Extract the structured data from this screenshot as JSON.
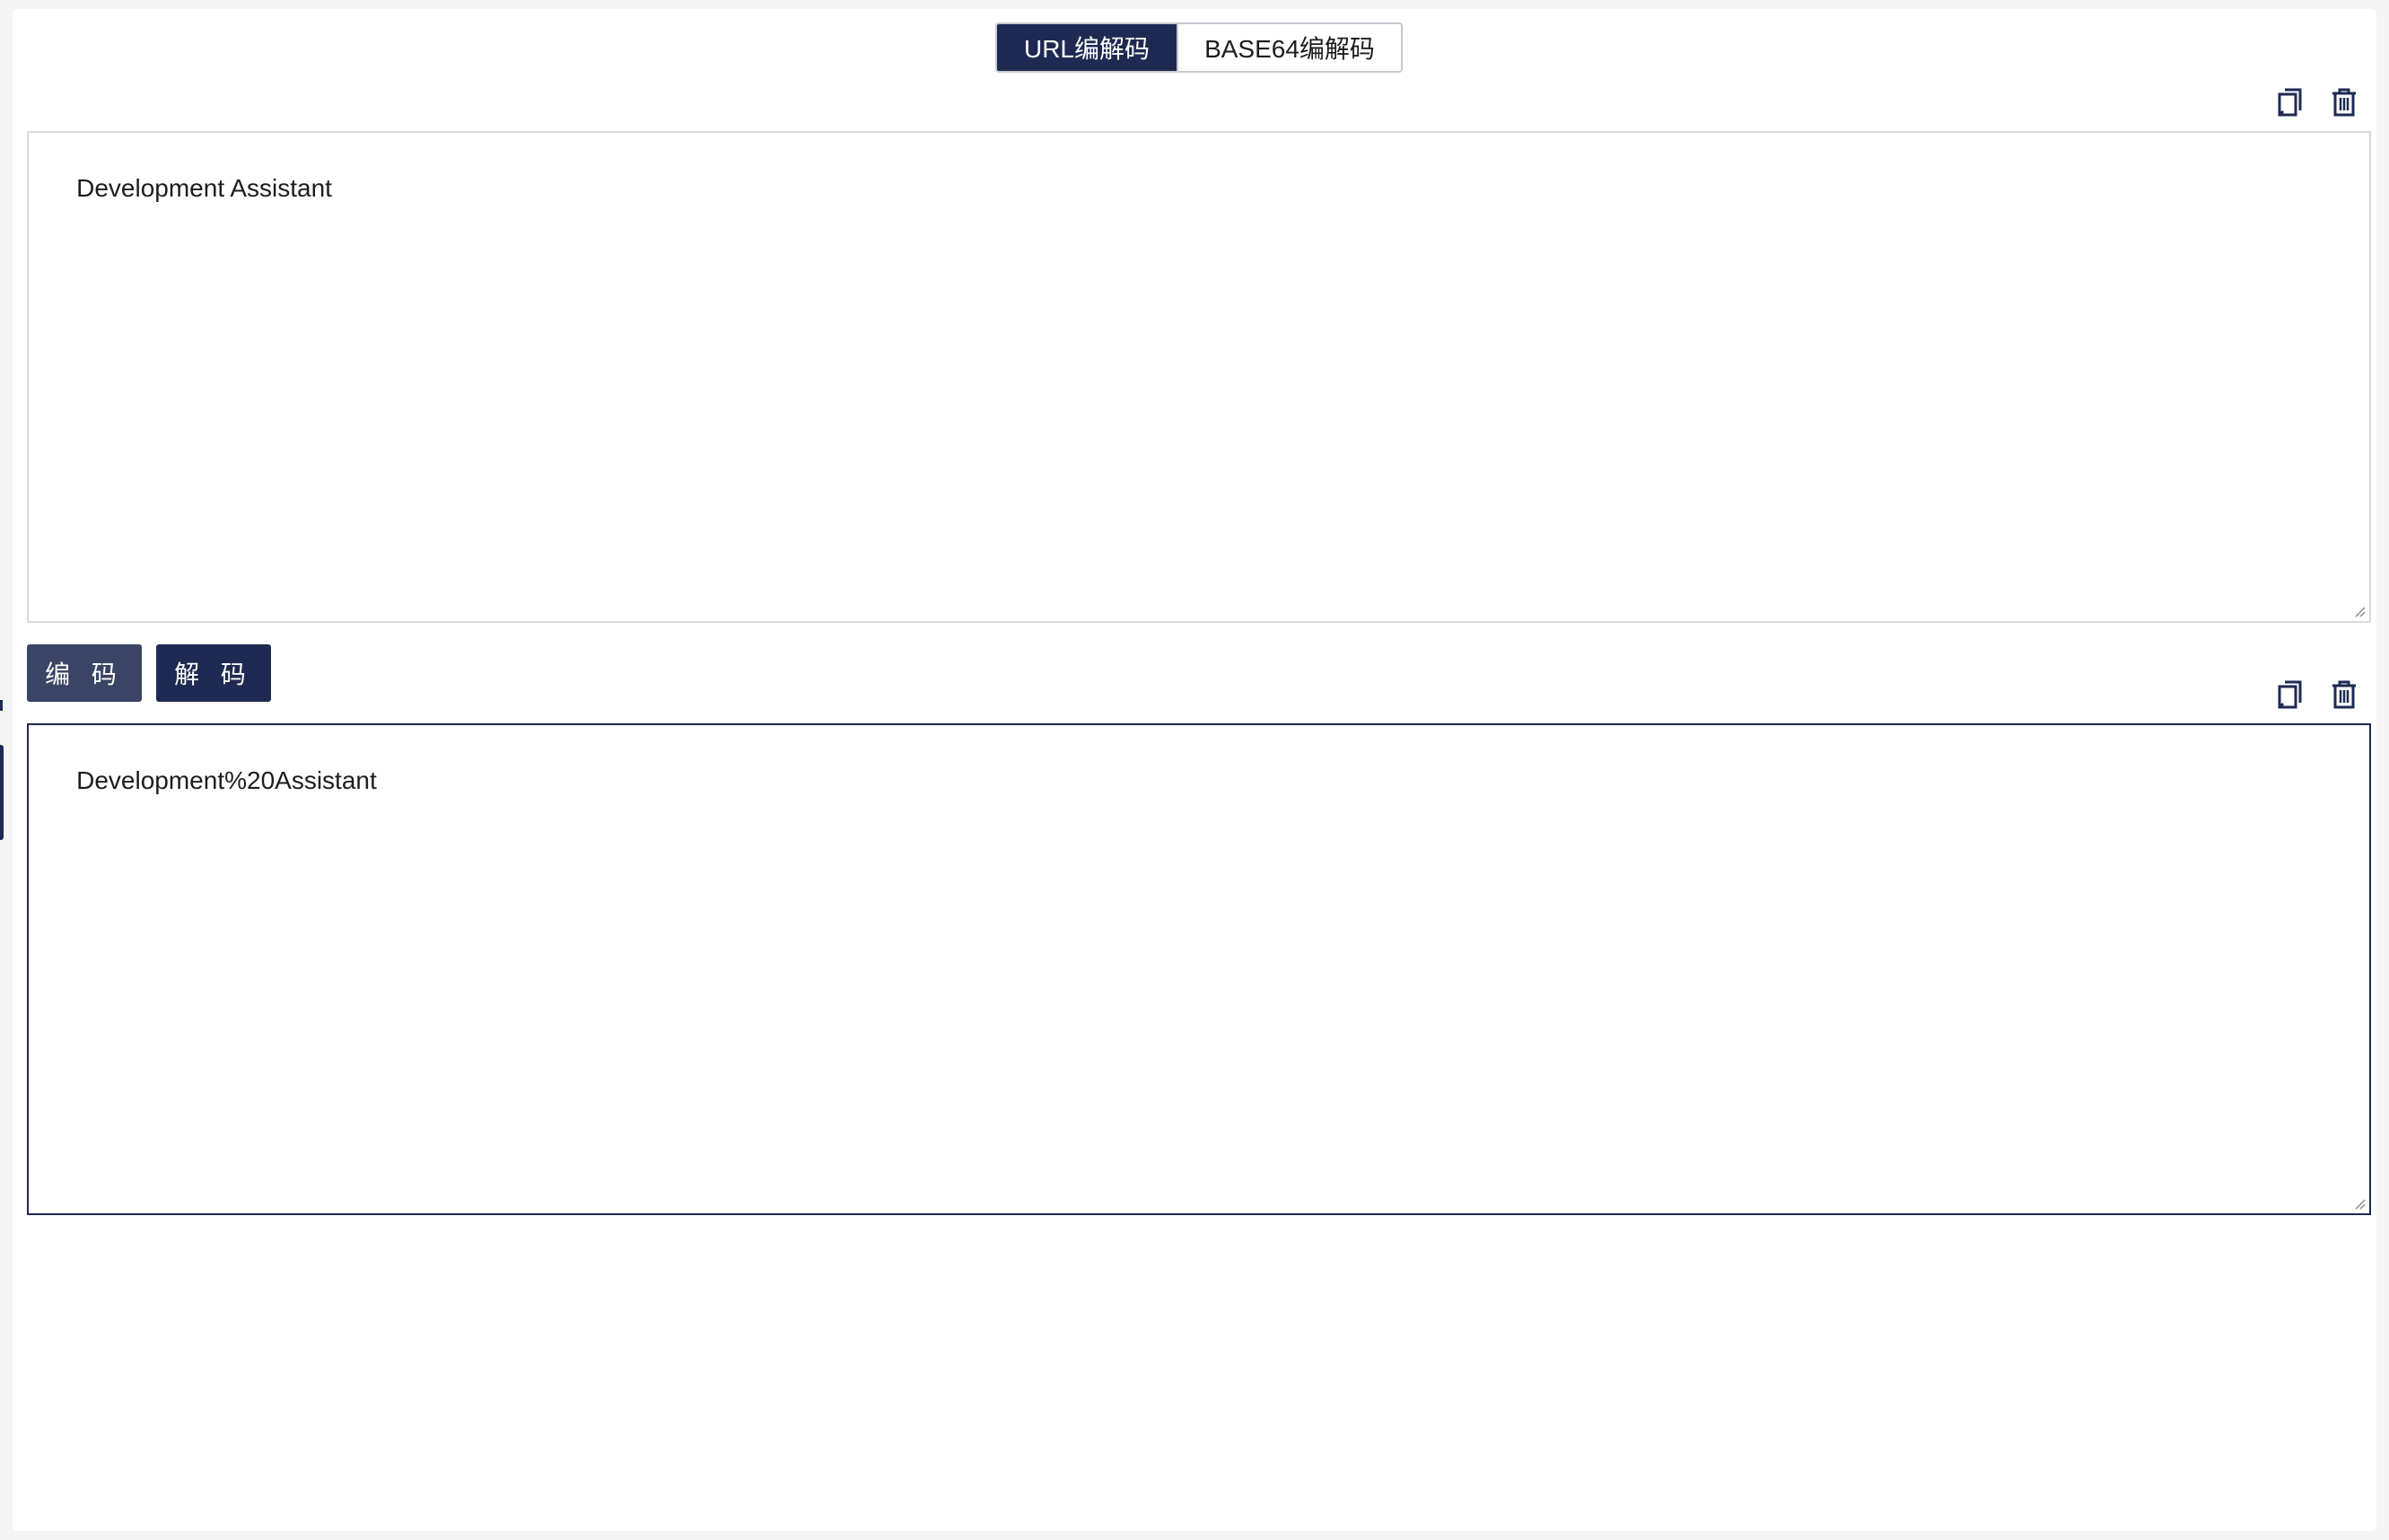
{
  "tabs": [
    {
      "label": "URL编解码",
      "active": true
    },
    {
      "label": "BASE64编解码",
      "active": false
    }
  ],
  "input": {
    "value": "Development Assistant"
  },
  "actions": {
    "encode_label": "编 码",
    "decode_label": "解 码"
  },
  "output": {
    "value": "Development%20Assistant"
  },
  "icons": {
    "copy": "copy-icon",
    "delete": "trash-icon"
  },
  "colors": {
    "primary": "#1f2a52",
    "secondary_button": "#3a4565",
    "border": "#d7d9de"
  }
}
